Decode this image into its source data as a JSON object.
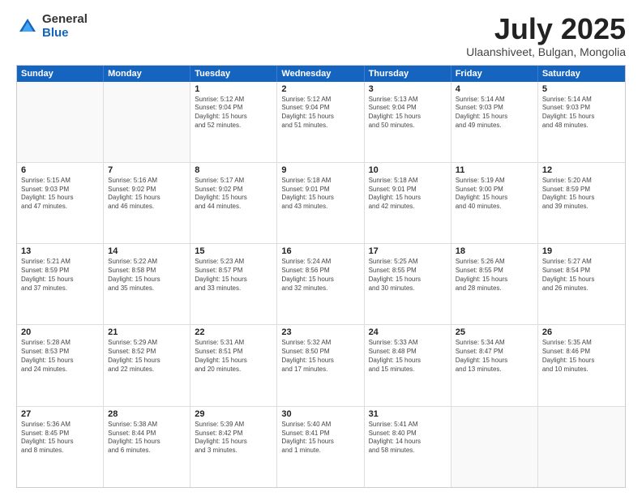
{
  "logo": {
    "general": "General",
    "blue": "Blue"
  },
  "title": "July 2025",
  "location": "Ulaanshiveet, Bulgan, Mongolia",
  "header_days": [
    "Sunday",
    "Monday",
    "Tuesday",
    "Wednesday",
    "Thursday",
    "Friday",
    "Saturday"
  ],
  "weeks": [
    [
      {
        "day": "",
        "info": ""
      },
      {
        "day": "",
        "info": ""
      },
      {
        "day": "1",
        "info": "Sunrise: 5:12 AM\nSunset: 9:04 PM\nDaylight: 15 hours\nand 52 minutes."
      },
      {
        "day": "2",
        "info": "Sunrise: 5:12 AM\nSunset: 9:04 PM\nDaylight: 15 hours\nand 51 minutes."
      },
      {
        "day": "3",
        "info": "Sunrise: 5:13 AM\nSunset: 9:04 PM\nDaylight: 15 hours\nand 50 minutes."
      },
      {
        "day": "4",
        "info": "Sunrise: 5:14 AM\nSunset: 9:03 PM\nDaylight: 15 hours\nand 49 minutes."
      },
      {
        "day": "5",
        "info": "Sunrise: 5:14 AM\nSunset: 9:03 PM\nDaylight: 15 hours\nand 48 minutes."
      }
    ],
    [
      {
        "day": "6",
        "info": "Sunrise: 5:15 AM\nSunset: 9:03 PM\nDaylight: 15 hours\nand 47 minutes."
      },
      {
        "day": "7",
        "info": "Sunrise: 5:16 AM\nSunset: 9:02 PM\nDaylight: 15 hours\nand 46 minutes."
      },
      {
        "day": "8",
        "info": "Sunrise: 5:17 AM\nSunset: 9:02 PM\nDaylight: 15 hours\nand 44 minutes."
      },
      {
        "day": "9",
        "info": "Sunrise: 5:18 AM\nSunset: 9:01 PM\nDaylight: 15 hours\nand 43 minutes."
      },
      {
        "day": "10",
        "info": "Sunrise: 5:18 AM\nSunset: 9:01 PM\nDaylight: 15 hours\nand 42 minutes."
      },
      {
        "day": "11",
        "info": "Sunrise: 5:19 AM\nSunset: 9:00 PM\nDaylight: 15 hours\nand 40 minutes."
      },
      {
        "day": "12",
        "info": "Sunrise: 5:20 AM\nSunset: 8:59 PM\nDaylight: 15 hours\nand 39 minutes."
      }
    ],
    [
      {
        "day": "13",
        "info": "Sunrise: 5:21 AM\nSunset: 8:59 PM\nDaylight: 15 hours\nand 37 minutes."
      },
      {
        "day": "14",
        "info": "Sunrise: 5:22 AM\nSunset: 8:58 PM\nDaylight: 15 hours\nand 35 minutes."
      },
      {
        "day": "15",
        "info": "Sunrise: 5:23 AM\nSunset: 8:57 PM\nDaylight: 15 hours\nand 33 minutes."
      },
      {
        "day": "16",
        "info": "Sunrise: 5:24 AM\nSunset: 8:56 PM\nDaylight: 15 hours\nand 32 minutes."
      },
      {
        "day": "17",
        "info": "Sunrise: 5:25 AM\nSunset: 8:55 PM\nDaylight: 15 hours\nand 30 minutes."
      },
      {
        "day": "18",
        "info": "Sunrise: 5:26 AM\nSunset: 8:55 PM\nDaylight: 15 hours\nand 28 minutes."
      },
      {
        "day": "19",
        "info": "Sunrise: 5:27 AM\nSunset: 8:54 PM\nDaylight: 15 hours\nand 26 minutes."
      }
    ],
    [
      {
        "day": "20",
        "info": "Sunrise: 5:28 AM\nSunset: 8:53 PM\nDaylight: 15 hours\nand 24 minutes."
      },
      {
        "day": "21",
        "info": "Sunrise: 5:29 AM\nSunset: 8:52 PM\nDaylight: 15 hours\nand 22 minutes."
      },
      {
        "day": "22",
        "info": "Sunrise: 5:31 AM\nSunset: 8:51 PM\nDaylight: 15 hours\nand 20 minutes."
      },
      {
        "day": "23",
        "info": "Sunrise: 5:32 AM\nSunset: 8:50 PM\nDaylight: 15 hours\nand 17 minutes."
      },
      {
        "day": "24",
        "info": "Sunrise: 5:33 AM\nSunset: 8:48 PM\nDaylight: 15 hours\nand 15 minutes."
      },
      {
        "day": "25",
        "info": "Sunrise: 5:34 AM\nSunset: 8:47 PM\nDaylight: 15 hours\nand 13 minutes."
      },
      {
        "day": "26",
        "info": "Sunrise: 5:35 AM\nSunset: 8:46 PM\nDaylight: 15 hours\nand 10 minutes."
      }
    ],
    [
      {
        "day": "27",
        "info": "Sunrise: 5:36 AM\nSunset: 8:45 PM\nDaylight: 15 hours\nand 8 minutes."
      },
      {
        "day": "28",
        "info": "Sunrise: 5:38 AM\nSunset: 8:44 PM\nDaylight: 15 hours\nand 6 minutes."
      },
      {
        "day": "29",
        "info": "Sunrise: 5:39 AM\nSunset: 8:42 PM\nDaylight: 15 hours\nand 3 minutes."
      },
      {
        "day": "30",
        "info": "Sunrise: 5:40 AM\nSunset: 8:41 PM\nDaylight: 15 hours\nand 1 minute."
      },
      {
        "day": "31",
        "info": "Sunrise: 5:41 AM\nSunset: 8:40 PM\nDaylight: 14 hours\nand 58 minutes."
      },
      {
        "day": "",
        "info": ""
      },
      {
        "day": "",
        "info": ""
      }
    ]
  ]
}
